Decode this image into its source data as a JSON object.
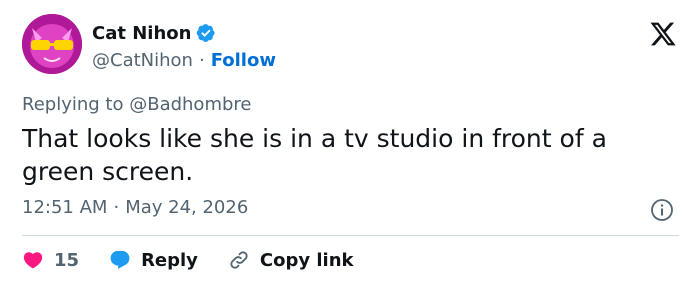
{
  "author": {
    "display_name": "Cat Nihon",
    "handle": "@CatNihon",
    "verified": true,
    "follow_label": "Follow",
    "separator": "·"
  },
  "reply_context": {
    "prefix": "Replying to",
    "mention": "@Badhombre"
  },
  "tweet": {
    "text": "That looks like she is in a tv studio in front of a green screen.",
    "time": "12:51 AM",
    "separator": "·",
    "date": "May 24, 2026"
  },
  "actions": {
    "like_count": "15",
    "reply_label": "Reply",
    "copy_link_label": "Copy link"
  },
  "icons": {
    "brand": "x-logo-icon",
    "verified": "verified-badge-icon",
    "info": "info-icon",
    "like": "heart-icon",
    "reply": "speech-bubble-icon",
    "copy": "link-icon"
  },
  "colors": {
    "accent_blue": "#1d9bf0",
    "like_red": "#f91880",
    "text_primary": "#0f1419",
    "text_secondary": "#536471",
    "follow_blue": "#006fd6"
  }
}
